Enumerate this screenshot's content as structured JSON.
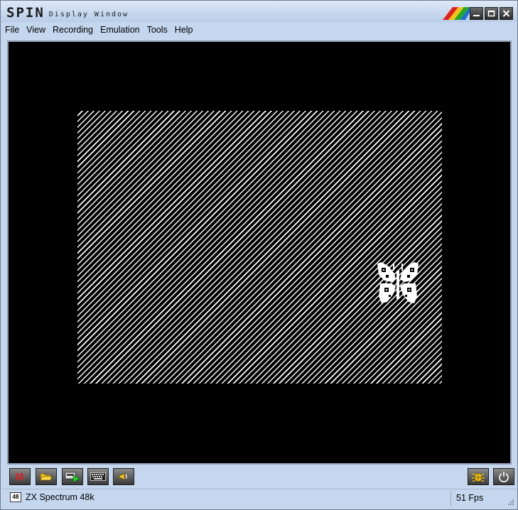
{
  "window": {
    "logo_text": "SPIN",
    "subtitle": "Display Window"
  },
  "menu": [
    "File",
    "View",
    "Recording",
    "Emulation",
    "Tools",
    "Help"
  ],
  "toolbar": {
    "buttons": [
      {
        "name": "pause",
        "icon": "pause-icon"
      },
      {
        "name": "open",
        "icon": "folder-open-icon"
      },
      {
        "name": "run-tape",
        "icon": "tape-play-icon"
      },
      {
        "name": "keyboard",
        "icon": "keyboard-icon"
      },
      {
        "name": "sound",
        "icon": "speaker-icon"
      },
      {
        "name": "debugger",
        "icon": "bug-icon"
      },
      {
        "name": "power",
        "icon": "power-icon"
      }
    ]
  },
  "status": {
    "model_badge": "48",
    "model": "ZX Spectrum 48k",
    "fps": "51 Fps"
  },
  "colors": {
    "frame": "#c5d7ee",
    "display_bg": "#000000",
    "pause_red": "#e02020",
    "folder_yellow": "#f2c418",
    "play_green": "#22cc22",
    "sprite": "#ffffff"
  }
}
